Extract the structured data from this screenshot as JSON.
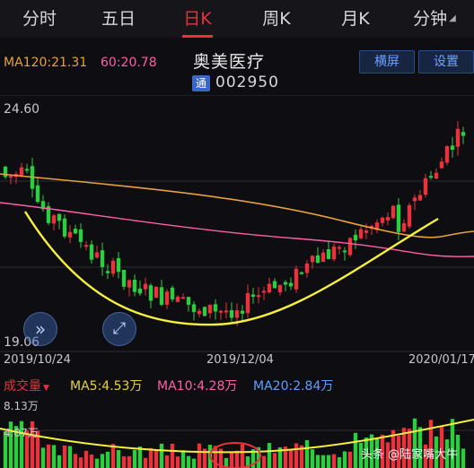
{
  "tabs": [
    "分时",
    "五日",
    "日K",
    "周K",
    "月K",
    "分钟"
  ],
  "active_tab": "日K",
  "ma_line": {
    "ma120": "MA120:21.31",
    "ma60": "60:20.78"
  },
  "stock": {
    "name": "奥美医疗",
    "badge": "通",
    "code": "002950"
  },
  "buttons": {
    "landscape": "横屏",
    "settings": "设置"
  },
  "price_axis": {
    "high": "24.60",
    "low": "19.06"
  },
  "dates": [
    "2019/10/24",
    "2019/12/04",
    "2020/01/17"
  ],
  "volume": {
    "title": "成交量",
    "ma5": "MA5:4.53万",
    "ma10": "MA10:4.28万",
    "ma20": "MA20:2.84万",
    "high": "8.13万",
    "mid": "4.07万"
  },
  "watermark": "头条 @陆家嘴大牛",
  "colors": {
    "up": "#e8323c",
    "down": "#2ecc40",
    "ma120": "#e6a23c",
    "ma60": "#ff5fa8",
    "annotation": "#f5f03c"
  },
  "icons": {
    "tab_caret": "caret-down-icon",
    "next": "double-chevron-right-icon",
    "fullscreen": "expand-icon"
  }
}
